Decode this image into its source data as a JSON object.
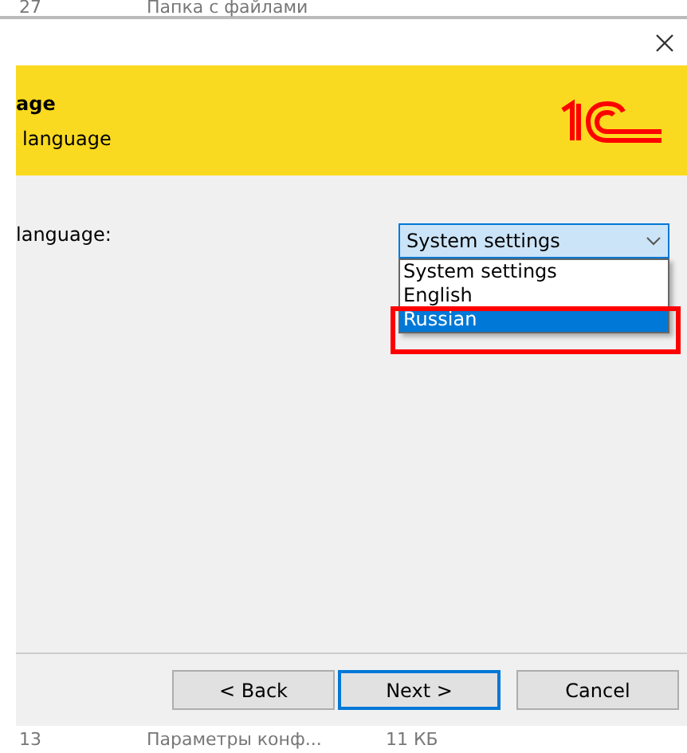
{
  "background_rows": [
    {
      "number": "27",
      "name": "Папка с файлами"
    },
    {
      "number": "13",
      "name": "Параметры конф...",
      "size": "11 КБ"
    }
  ],
  "header": {
    "title": "age",
    "subtitle": "language"
  },
  "language_field": {
    "label": "language:",
    "value": "System settings",
    "expanded": true,
    "options": [
      {
        "label": "System settings",
        "highlighted": false
      },
      {
        "label": "English",
        "highlighted": false
      },
      {
        "label": "Russian",
        "highlighted": true
      }
    ]
  },
  "buttons": [
    {
      "label": "< Back",
      "default": false
    },
    {
      "label": "Next >",
      "default": true
    },
    {
      "label": "Cancel",
      "default": false
    }
  ]
}
